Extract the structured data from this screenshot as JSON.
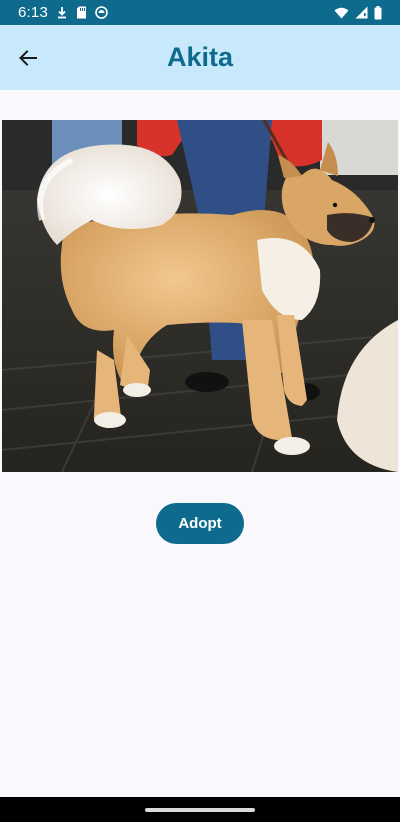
{
  "status_bar": {
    "time": "6:13",
    "left_icons": [
      "download-icon",
      "sd-card-icon",
      "sync-icon"
    ],
    "right_icons": [
      "wifi-icon",
      "signal-icon",
      "battery-icon"
    ]
  },
  "app_bar": {
    "back_icon": "arrow-back-icon",
    "title": "Akita"
  },
  "photo": {
    "subject": "dog-photo"
  },
  "actions": {
    "adopt_label": "Adopt"
  },
  "colors": {
    "primary": "#0F6B8E",
    "app_bar_bg": "#C8E9FB",
    "background": "#F9F9FD"
  }
}
